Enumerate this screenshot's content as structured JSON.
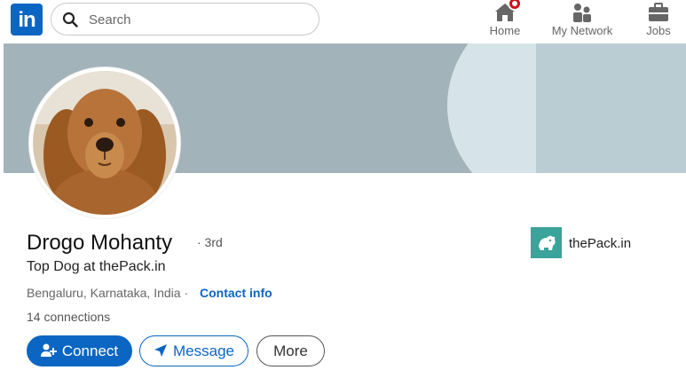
{
  "header": {
    "logo": "in",
    "search": {
      "placeholder": "Search"
    },
    "nav": [
      {
        "label": "Home",
        "icon": "home-icon"
      },
      {
        "label": "My Network",
        "icon": "network-icon"
      },
      {
        "label": "Jobs",
        "icon": "briefcase-icon"
      }
    ]
  },
  "profile": {
    "name": "Drogo Mohanty",
    "degree": "· 3rd",
    "headline": "Top Dog at thePack.in",
    "location": "Bengaluru, Karnataka, India ·",
    "contact_label": "Contact info",
    "connections": "14 connections",
    "company": {
      "name": "thePack.in",
      "color": "#3aa39a"
    }
  },
  "actions": {
    "connect": "Connect",
    "message": "Message",
    "more": "More"
  },
  "colors": {
    "brand": "#0a66c2",
    "notification": "#cc1016"
  }
}
